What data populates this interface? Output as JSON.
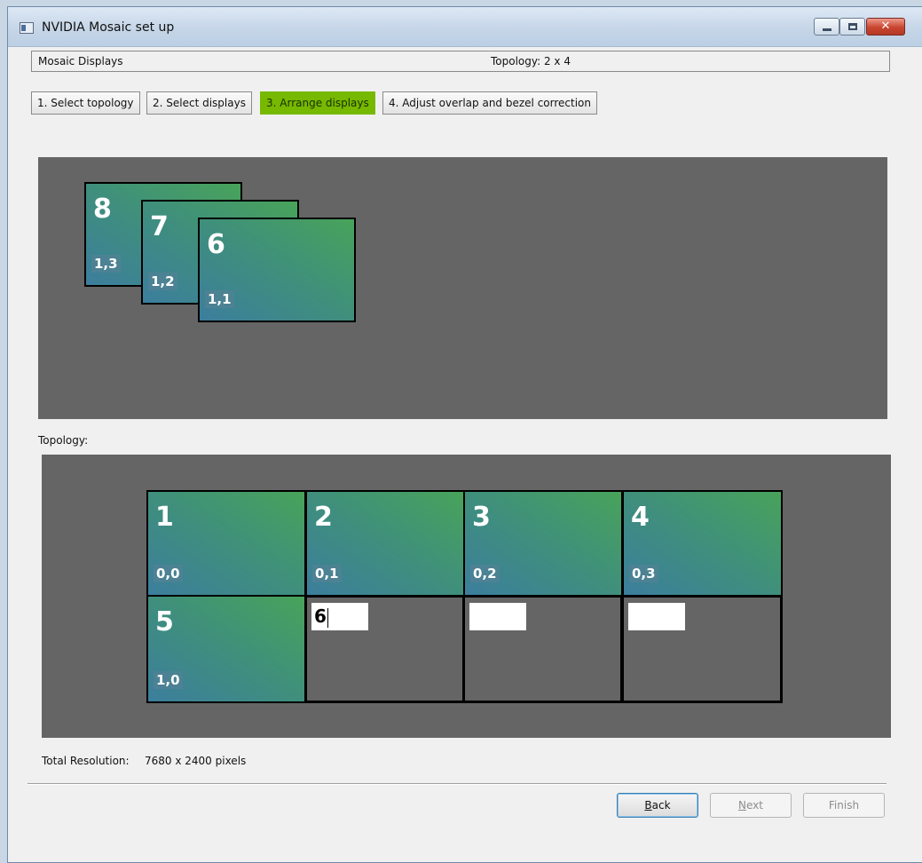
{
  "window": {
    "title": "NVIDIA Mosaic set up"
  },
  "header": {
    "left": "Mosaic Displays",
    "right": "Topology: 2 x 4"
  },
  "steps": [
    {
      "label": "1. Select topology",
      "active": false
    },
    {
      "label": "2. Select displays",
      "active": false
    },
    {
      "label": "3. Arrange displays",
      "active": true
    },
    {
      "label": "4. Adjust overlap and bezel correction",
      "active": false
    }
  ],
  "arrange": {
    "displays": [
      {
        "number": "8",
        "coord": "1,3"
      },
      {
        "number": "7",
        "coord": "1,2"
      },
      {
        "number": "6",
        "coord": "1,1"
      }
    ]
  },
  "topology": {
    "label": "Topology:",
    "grid": [
      {
        "number": "1",
        "coord": "0,0"
      },
      {
        "number": "2",
        "coord": "0,1"
      },
      {
        "number": "3",
        "coord": "0,2"
      },
      {
        "number": "4",
        "coord": "0,3"
      },
      {
        "number": "5",
        "coord": "1,0"
      },
      {
        "input_value": "6"
      },
      {
        "input_value": ""
      },
      {
        "input_value": ""
      }
    ]
  },
  "footer": {
    "total_label": "Total Resolution:",
    "total_value": "7680 x 2400 pixels",
    "back_label": "Back",
    "back_mnemonic": "B",
    "back_rest": "ack",
    "next_label": "Next",
    "next_mnemonic": "N",
    "next_rest": "ext",
    "finish_label": "Finish",
    "next_enabled": false,
    "finish_enabled": false
  },
  "colors": {
    "nvidia_green": "#76b900",
    "canvas_gray": "#656565",
    "tile_gradient_start": "#3c7e9d",
    "tile_gradient_end": "#48a35a"
  },
  "icons": [
    "app-icon",
    "minimize-icon",
    "maximize-icon",
    "close-icon"
  ]
}
